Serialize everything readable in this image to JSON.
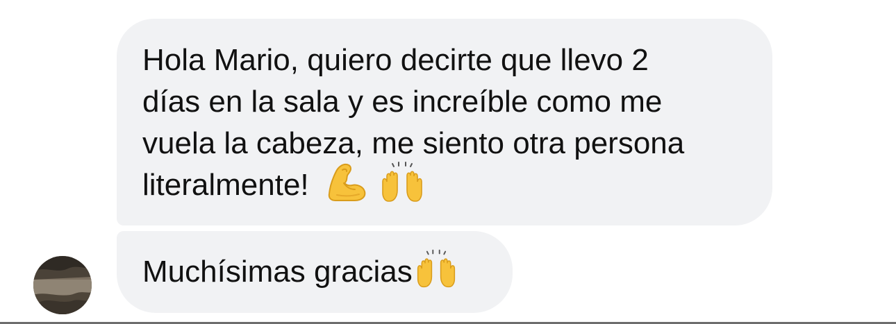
{
  "messages": [
    {
      "lines": [
        "Hola Mario, quiero decirte que llevo 2",
        "días en la sala y es increíble como me",
        "vuela la cabeza, me siento otra persona",
        "literalmente!"
      ],
      "emojis": [
        "flexed-biceps-icon",
        "raising-hands-icon"
      ]
    },
    {
      "text": "Muchísimas gracias",
      "emojis": [
        "raising-hands-icon"
      ]
    }
  ],
  "colors": {
    "bubble_background": "#f1f2f4",
    "text": "#111111",
    "emoji_yellow": "#f7c23b"
  }
}
